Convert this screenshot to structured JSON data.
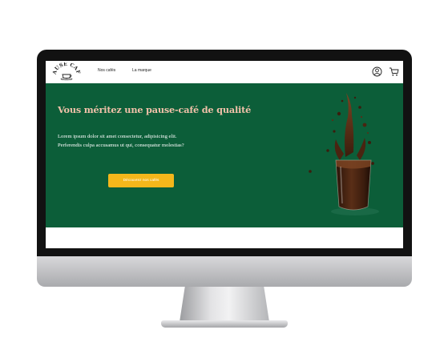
{
  "brand": {
    "logo_text": "PAUSE CAFÉ"
  },
  "nav": {
    "links": [
      {
        "label": "Nos cafés"
      },
      {
        "label": "La marque"
      }
    ],
    "icons": [
      "user-icon",
      "cart-icon"
    ]
  },
  "hero": {
    "title": "Vous méritez une pause-café de qualité",
    "text_line_1": "Lorem ipsum dolor sit amet consectetur, adipisicing elit.",
    "text_line_2": "Perferendis culpa accusamus ut qui, consequatur molestias?",
    "cta_label": "Découvrez nos cafés",
    "image": "coffee-splash-glass"
  },
  "colors": {
    "hero_background": "#0c5e39",
    "title_color": "#f1c1a9",
    "cta_background": "#f4b71b",
    "bezel": "#121212"
  }
}
